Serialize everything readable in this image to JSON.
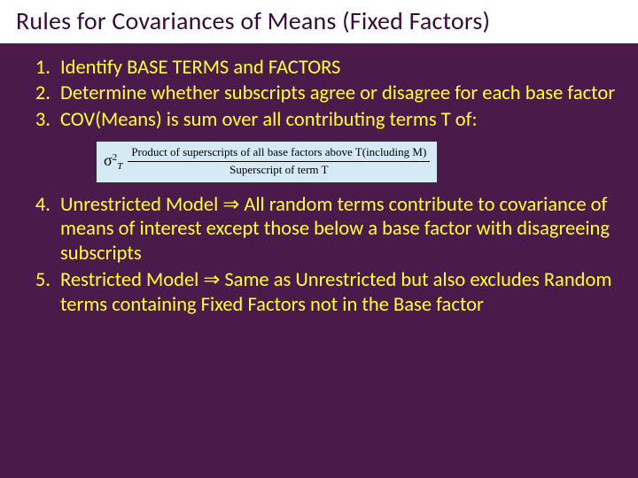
{
  "title": "Rules for Covariances of Means (Fixed Factors)",
  "items": {
    "i1": "Identify BASE TERMS and FACTORS",
    "i2": "Determine whether subscripts agree or disagree for each base factor",
    "i3": "COV(Means) is sum over all contributing terms T of:",
    "i4a": "Unrestricted Model ",
    "i4b": " All random terms contribute to covariance of means of interest except those below a base factor with disagreeing subscripts",
    "i5a": "Restricted Model ",
    "i5b": " Same as Unrestricted but also excludes Random terms containing Fixed Factors not in the Base factor"
  },
  "implies": "⇒",
  "formula": {
    "sigma": "σ",
    "sigma_sup": "2",
    "sigma_sub": "T",
    "numerator": "Product of superscripts of all base factors above T(including M)",
    "denominator": "Superscript of term T"
  }
}
